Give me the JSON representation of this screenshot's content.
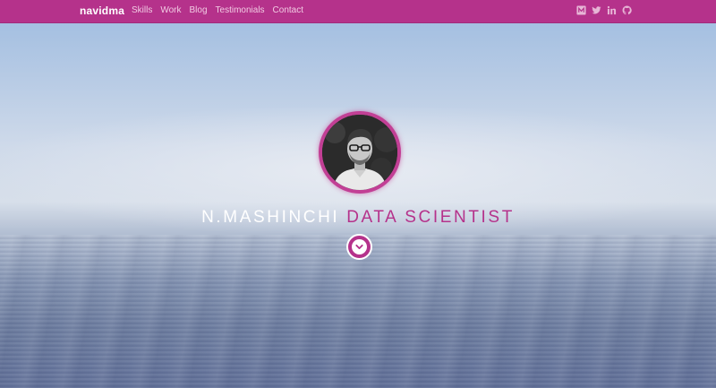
{
  "navbar": {
    "brand": "navidma",
    "links": [
      "Skills",
      "Work",
      "Blog",
      "Testimonials",
      "Contact"
    ],
    "socials": [
      "medium-icon",
      "twitter-icon",
      "linkedin-icon",
      "github-icon"
    ]
  },
  "hero": {
    "name": "N.MASHINCHI",
    "role": "DATA SCIENTIST",
    "scroll_icon": "chevron-down-icon"
  },
  "colors": {
    "accent": "#b5328b",
    "nav_link": "#f1cbe3",
    "headline": "#ffffff"
  }
}
